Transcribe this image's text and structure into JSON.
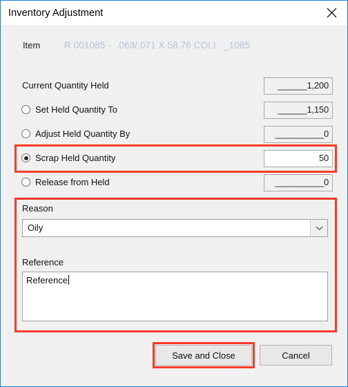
{
  "window": {
    "title": "Inventory Adjustment",
    "close_icon": "close-icon"
  },
  "item": {
    "label": "Item",
    "value": "R 001085 -  .063/.071 X 58.76 COLI   _1085"
  },
  "quantities": [
    {
      "label": "Current Quantity Held",
      "has_radio": false,
      "selected": false,
      "field_value": "______1,200",
      "field_active": false
    },
    {
      "label": "Set Held Quantity To",
      "has_radio": true,
      "selected": false,
      "field_value": "______1,150",
      "field_active": false
    },
    {
      "label": "Adjust Held Quantity By",
      "has_radio": true,
      "selected": false,
      "field_value": "__________0",
      "field_active": false
    },
    {
      "label": "Scrap Held Quantity",
      "has_radio": true,
      "selected": true,
      "field_value": "50",
      "field_active": true
    },
    {
      "label": "Release from Held",
      "has_radio": true,
      "selected": false,
      "field_value": "__________0",
      "field_active": false
    }
  ],
  "reason": {
    "label": "Reason",
    "selected": "Oily",
    "dropdown_icon": "chevron-down-icon"
  },
  "reference": {
    "label": "Reference",
    "value": "Reference"
  },
  "footer": {
    "save_label": "Save and Close",
    "cancel_label": "Cancel"
  },
  "annotations": {
    "highlight_color": "#f93a26"
  }
}
